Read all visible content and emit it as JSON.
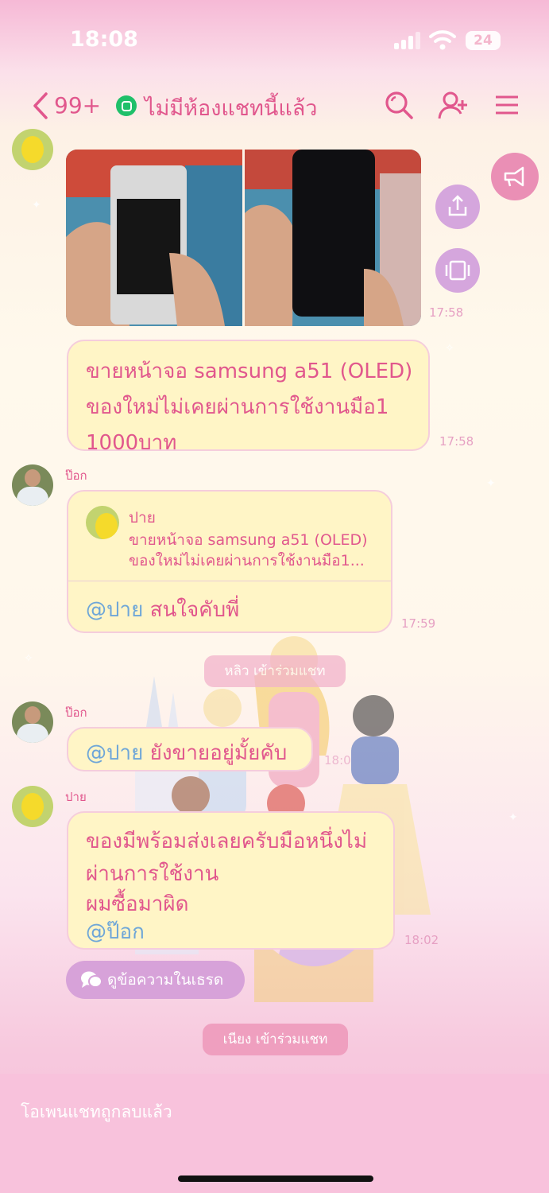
{
  "status_bar": {
    "time": "18:08",
    "battery": "24"
  },
  "header": {
    "unread_count": "99+",
    "title": "ไม่มีห้องแชทนี้แล้ว"
  },
  "messages": [
    {
      "sender": "ปาย",
      "type": "images",
      "time": "17:58"
    },
    {
      "sender": "ปาย",
      "type": "text",
      "lines": [
        "ขายหน้าจอ samsung a51 (OLED)",
        "ของใหม่ไม่เคยผ่านการใช้งานมือ1",
        "1000บาท"
      ],
      "time": "17:58"
    },
    {
      "sender": "ป๊อก",
      "type": "reply",
      "quote_name": "ปาย",
      "quote_lines": [
        "ขายหน้าจอ samsung a51 (OLED)",
        "ของใหม่ไม่เคยผ่านการใช้งานมือ1..."
      ],
      "mention": "@ปาย",
      "text": "สนใจคับพี่",
      "time": "17:59"
    },
    {
      "sender": "ป๊อก",
      "type": "text",
      "mention": "@ปาย",
      "text": "ยังขายอยู่มั้ยคับ",
      "time": "18:0"
    },
    {
      "sender": "ปาย",
      "type": "text",
      "lines": [
        "ของมีพร้อมส่งเลยครับมือหนึ่งไม่",
        "ผ่านการใช้งาน",
        "ผมซื้อมาผิด"
      ],
      "mention": "@ป๊อก",
      "time": "18:02"
    }
  ],
  "system": {
    "join_1": "หลิว เข้าร่วมแชท",
    "join_2": "เนียง เข้าร่วมแชท"
  },
  "thread_button": "ดูข้อความในเธรด",
  "input": {
    "placeholder": "โอเพนแชทถูกลบแล้ว"
  },
  "colors": {
    "accent": "#e1578d",
    "bubble": "#fff5c6",
    "mention": "#6ea6d8",
    "timestamp": "#e6a0c3"
  }
}
